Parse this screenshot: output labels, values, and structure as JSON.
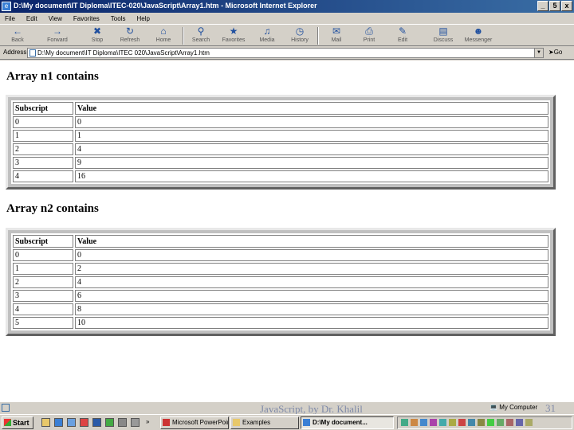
{
  "window": {
    "title": "D:\\My document\\IT Diploma\\ITEC-020\\JavaScript\\Array1.htm - Microsoft Internet Explorer",
    "buttons": [
      "_",
      "5",
      "x"
    ]
  },
  "menu": [
    "File",
    "Edit",
    "View",
    "Favorites",
    "Tools",
    "Help"
  ],
  "toolbar": [
    "Back",
    "Forward",
    "Stop",
    "Refresh",
    "Home",
    "Search",
    "Favorites",
    "Media",
    "History",
    "Mail",
    "Print",
    "Edit",
    "Discuss",
    "Messenger"
  ],
  "address": {
    "label": "Address",
    "value": "D:\\My document\\IT Diploma\\ITEC 020\\JavaScript\\Array1.htm",
    "go": "Go"
  },
  "content": {
    "heading1": "Array n1 contains",
    "heading2": "Array n2 contains",
    "col_subscript": "Subscript",
    "col_value": "Value",
    "table1": [
      [
        "0",
        "0"
      ],
      [
        "1",
        "1"
      ],
      [
        "2",
        "4"
      ],
      [
        "3",
        "9"
      ],
      [
        "4",
        "16"
      ]
    ],
    "table2": [
      [
        "0",
        "0"
      ],
      [
        "1",
        "2"
      ],
      [
        "2",
        "4"
      ],
      [
        "3",
        "6"
      ],
      [
        "4",
        "8"
      ],
      [
        "5",
        "10"
      ]
    ]
  },
  "status": {
    "watermark": "JavaScript, by Dr. Khalil",
    "zone": "My Computer",
    "page": "31"
  },
  "taskbar": {
    "start": "Start",
    "tasks": [
      "Microsoft PowerPoint...",
      "Examples",
      "D:\\My document..."
    ],
    "active_index": 2
  }
}
